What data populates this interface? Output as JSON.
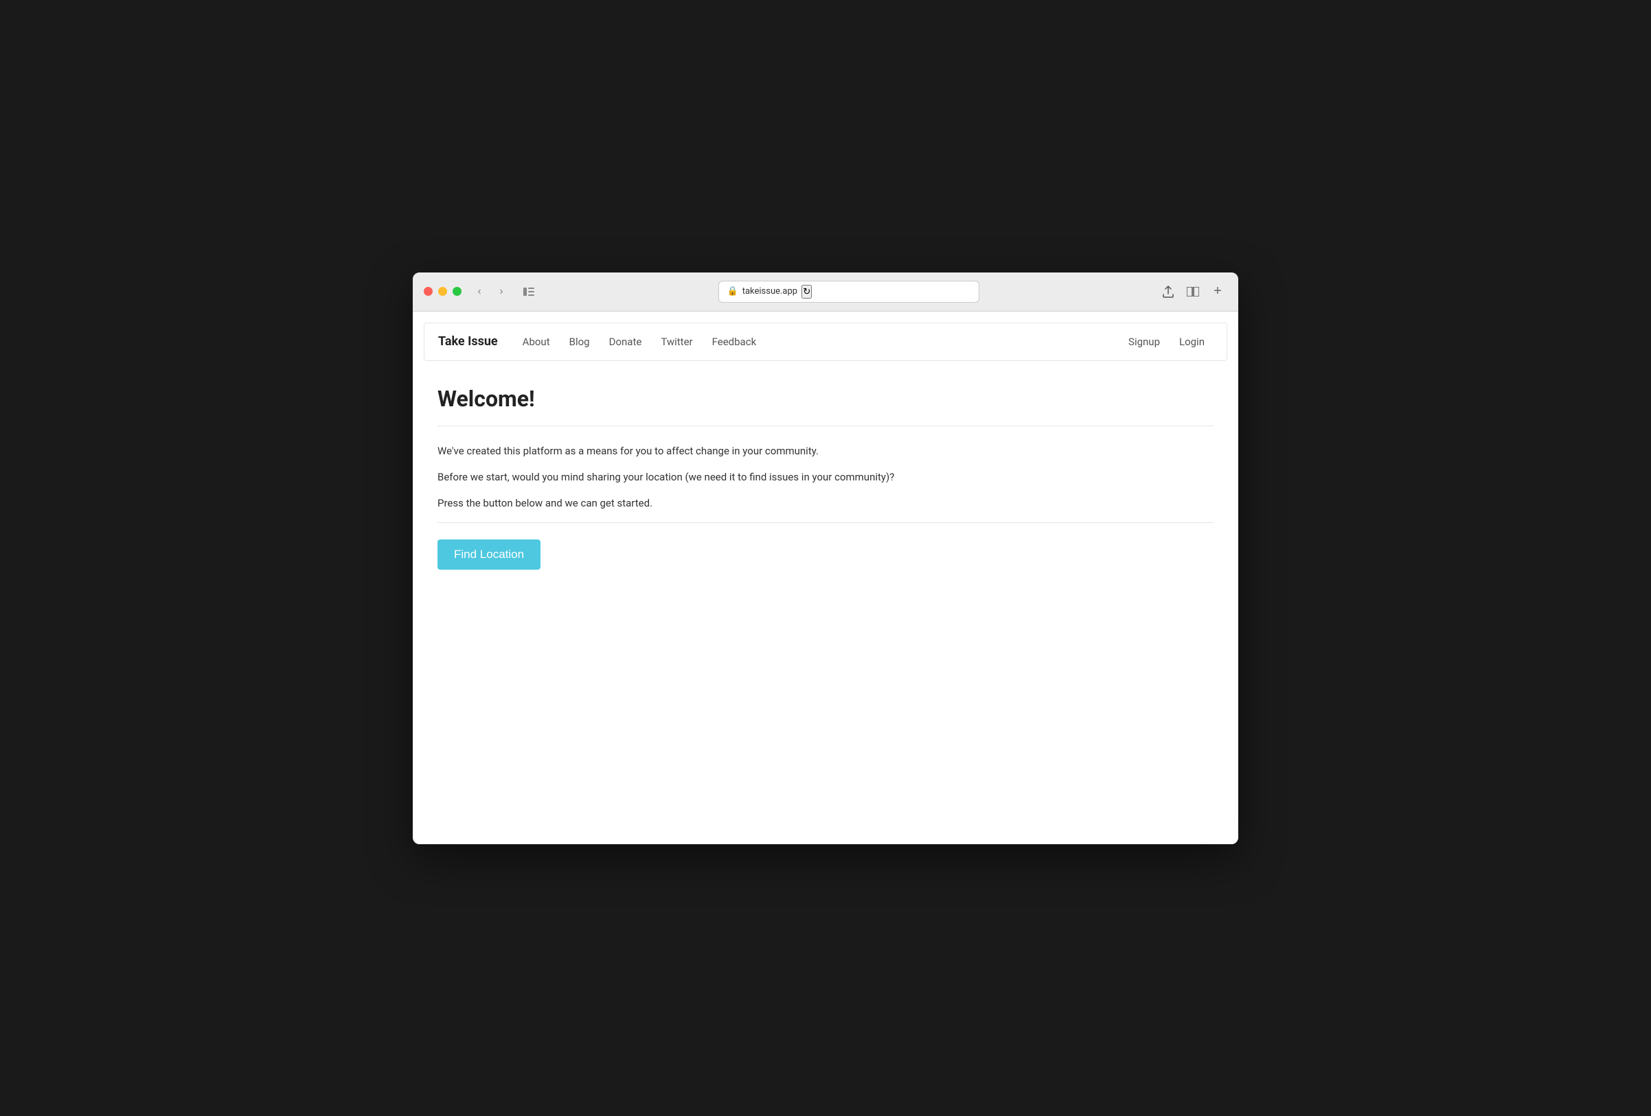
{
  "browser": {
    "url": "takeissue.app",
    "lock_icon": "🔒",
    "refresh_icon": "↻"
  },
  "navbar": {
    "brand": "Take Issue",
    "links": [
      {
        "label": "About",
        "href": "#"
      },
      {
        "label": "Blog",
        "href": "#"
      },
      {
        "label": "Donate",
        "href": "#"
      },
      {
        "label": "Twitter",
        "href": "#"
      },
      {
        "label": "Feedback",
        "href": "#"
      }
    ],
    "right_links": [
      {
        "label": "Signup",
        "href": "#"
      },
      {
        "label": "Login",
        "href": "#"
      }
    ]
  },
  "main": {
    "title": "Welcome!",
    "paragraph1": "We've created this platform as a means for you to affect change in your community.",
    "paragraph2": "Before we start, would you mind sharing your location (we need it to find issues in your community)?",
    "paragraph3": "Press the button below and we can get started.",
    "find_location_btn": "Find Location"
  }
}
